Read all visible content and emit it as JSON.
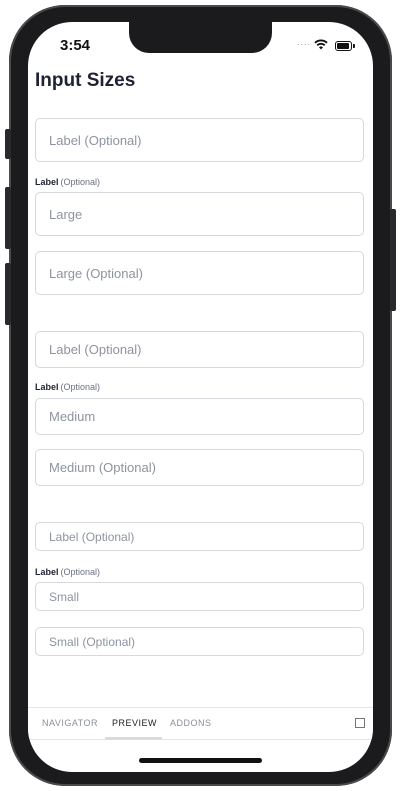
{
  "status": {
    "time": "3:54",
    "signal_dots": "....",
    "wifi_icon": "wifi-icon",
    "battery_icon": "battery-icon"
  },
  "page": {
    "title": "Input Sizes"
  },
  "large": {
    "field1_placeholder": "Label (Optional)",
    "label": "Label",
    "label_optional": "(Optional)",
    "field2_placeholder": "Large",
    "field3_placeholder": "Large (Optional)"
  },
  "medium": {
    "field1_placeholder": "Label (Optional)",
    "label": "Label",
    "label_optional": "(Optional)",
    "field2_placeholder": "Medium",
    "field3_placeholder": "Medium (Optional)"
  },
  "small": {
    "field1_placeholder": "Label (Optional)",
    "label": "Label",
    "label_optional": "(Optional)",
    "field2_placeholder": "Small",
    "field3_placeholder": "Small (Optional)"
  },
  "tabs": [
    {
      "label": "NAVIGATOR"
    },
    {
      "label": "PREVIEW"
    },
    {
      "label": "ADDONS"
    }
  ],
  "active_tab": "PREVIEW",
  "colors": {
    "title": "#1f2233",
    "placeholder": "#8e93a1",
    "border": "#d6d8de"
  }
}
